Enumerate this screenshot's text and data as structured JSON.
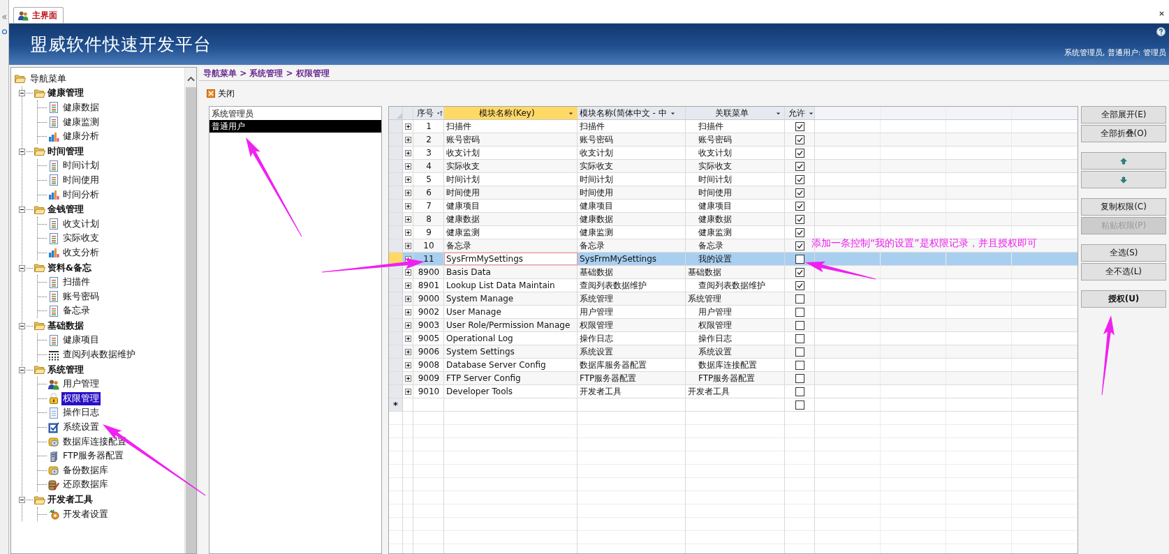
{
  "tab": {
    "label": "主界面",
    "selected": true
  },
  "header": {
    "title": "盟威软件快速开发平台",
    "user": "系统管理员, 普通用户: 管理员"
  },
  "nav": {
    "label": "导航菜单",
    "expanded": true,
    "children": [
      {
        "label": "健康管理",
        "expanded": true,
        "children": [
          {
            "label": "健康数据",
            "kind": "doc",
            "selected": false
          },
          {
            "label": "健康监测",
            "kind": "doc",
            "selected": false
          },
          {
            "label": "健康分析",
            "kind": "chart",
            "selected": false
          }
        ]
      },
      {
        "label": "时间管理",
        "expanded": true,
        "children": [
          {
            "label": "时间计划",
            "kind": "doc",
            "selected": false
          },
          {
            "label": "时间使用",
            "kind": "doc",
            "selected": false
          },
          {
            "label": "时间分析",
            "kind": "chart",
            "selected": false
          }
        ]
      },
      {
        "label": "金钱管理",
        "expanded": true,
        "children": [
          {
            "label": "收支计划",
            "kind": "doc",
            "selected": false
          },
          {
            "label": "实际收支",
            "kind": "doc",
            "selected": false
          },
          {
            "label": "收支分析",
            "kind": "chart",
            "selected": false
          }
        ]
      },
      {
        "label": "资料&备忘",
        "expanded": true,
        "children": [
          {
            "label": "扫描件",
            "kind": "doc",
            "selected": false
          },
          {
            "label": "账号密码",
            "kind": "doc",
            "selected": false
          },
          {
            "label": "备忘录",
            "kind": "doc",
            "selected": false
          }
        ]
      },
      {
        "label": "基础数据",
        "expanded": true,
        "children": [
          {
            "label": "健康项目",
            "kind": "doc",
            "selected": false
          },
          {
            "label": "查阅列表数据维护",
            "kind": "table",
            "selected": false
          }
        ]
      },
      {
        "label": "系统管理",
        "expanded": true,
        "children": [
          {
            "label": "用户管理",
            "kind": "users",
            "selected": false
          },
          {
            "label": "权限管理",
            "kind": "lock",
            "selected": true
          },
          {
            "label": "操作日志",
            "kind": "log",
            "selected": false
          },
          {
            "label": "系统设置",
            "kind": "settings",
            "selected": false
          },
          {
            "label": "数据库连接配置",
            "kind": "db",
            "selected": false
          },
          {
            "label": "FTP服务器配置",
            "kind": "server",
            "selected": false
          },
          {
            "label": "备份数据库",
            "kind": "db",
            "selected": false
          },
          {
            "label": "还原数据库",
            "kind": "restore",
            "selected": false
          }
        ]
      },
      {
        "label": "开发者工具",
        "expanded": true,
        "children": [
          {
            "label": "开发者设置",
            "kind": "devtools",
            "selected": false
          }
        ]
      }
    ]
  },
  "breadcrumb": "导航菜单 > 系统管理 > 权限管理",
  "toolbar": {
    "close": "关闭"
  },
  "roles": [
    {
      "label": "系统管理员",
      "selected": false
    },
    {
      "label": "普通用户",
      "selected": true
    }
  ],
  "columns": [
    {
      "label": "序号",
      "selected": false,
      "kind": "sort"
    },
    {
      "label": "模块名称(Key)",
      "selected": true,
      "kind": "filter"
    },
    {
      "label": "模块名称(简体中文 - 中",
      "selected": false,
      "kind": "filter"
    },
    {
      "label": "关联菜单",
      "selected": false,
      "kind": "filter"
    },
    {
      "label": "允许",
      "selected": false,
      "kind": "filter"
    }
  ],
  "rows": [
    {
      "seq": "1",
      "key": "扫描件",
      "name": "扫描件",
      "menu": "扫描件",
      "kind": "item",
      "allowed": true,
      "selected": false
    },
    {
      "seq": "2",
      "key": "账号密码",
      "name": "账号密码",
      "menu": "账号密码",
      "kind": "item",
      "allowed": true,
      "selected": false
    },
    {
      "seq": "3",
      "key": "收支计划",
      "name": "收支计划",
      "menu": "收支计划",
      "kind": "item",
      "allowed": true,
      "selected": false
    },
    {
      "seq": "4",
      "key": "实际收支",
      "name": "实际收支",
      "menu": "实际收支",
      "kind": "item",
      "allowed": true,
      "selected": false
    },
    {
      "seq": "5",
      "key": "时间计划",
      "name": "时间计划",
      "menu": "时间计划",
      "kind": "item",
      "allowed": true,
      "selected": false
    },
    {
      "seq": "6",
      "key": "时间使用",
      "name": "时间使用",
      "menu": "时间使用",
      "kind": "item",
      "allowed": true,
      "selected": false
    },
    {
      "seq": "7",
      "key": "健康项目",
      "name": "健康项目",
      "menu": "健康项目",
      "kind": "item",
      "allowed": true,
      "selected": false
    },
    {
      "seq": "8",
      "key": "健康数据",
      "name": "健康数据",
      "menu": "健康数据",
      "kind": "item",
      "allowed": true,
      "selected": false
    },
    {
      "seq": "9",
      "key": "健康监测",
      "name": "健康监测",
      "menu": "健康监测",
      "kind": "item",
      "allowed": true,
      "selected": false
    },
    {
      "seq": "10",
      "key": "备忘录",
      "name": "备忘录",
      "menu": "备忘录",
      "kind": "item",
      "allowed": true,
      "selected": false
    },
    {
      "seq": "11",
      "key": "SysFrmMySettings",
      "name": "SysFrmMySettings",
      "menu": "我的设置",
      "kind": "item",
      "allowed": false,
      "selected": true
    },
    {
      "seq": "8900",
      "key": "Basis Data",
      "name": "基础数据",
      "menu": "基础数据",
      "kind": "group",
      "allowed": true,
      "selected": false
    },
    {
      "seq": "8901",
      "key": "Lookup List Data Maintain",
      "name": "查阅列表数据维护",
      "menu": "查阅列表数据维护",
      "kind": "item",
      "allowed": true,
      "selected": false
    },
    {
      "seq": "9000",
      "key": "System Manage",
      "name": "系统管理",
      "menu": "系统管理",
      "kind": "group",
      "allowed": false,
      "selected": false
    },
    {
      "seq": "9002",
      "key": "User Manage",
      "name": "用户管理",
      "menu": "用户管理",
      "kind": "item",
      "allowed": false,
      "selected": false
    },
    {
      "seq": "9003",
      "key": "User Role/Permission Manage",
      "name": "权限管理",
      "menu": "权限管理",
      "kind": "item",
      "allowed": false,
      "selected": false
    },
    {
      "seq": "9005",
      "key": "Operational Log",
      "name": "操作日志",
      "menu": "操作日志",
      "kind": "item",
      "allowed": false,
      "selected": false
    },
    {
      "seq": "9006",
      "key": "System Settings",
      "name": "系统设置",
      "menu": "系统设置",
      "kind": "item",
      "allowed": false,
      "selected": false
    },
    {
      "seq": "9008",
      "key": "Database Server Config",
      "name": "数据库服务器配置",
      "menu": "数据库连接配置",
      "kind": "item",
      "allowed": false,
      "selected": false
    },
    {
      "seq": "9009",
      "key": "FTP Server Config",
      "name": "FTP服务器配置",
      "menu": "FTP服务器配置",
      "kind": "item",
      "allowed": false,
      "selected": false
    },
    {
      "seq": "9010",
      "key": "Developer Tools",
      "name": "开发者工具",
      "menu": "开发者工具",
      "kind": "group",
      "allowed": false,
      "selected": false
    }
  ],
  "new_row": {
    "marker": "*",
    "allowed": false
  },
  "button_groups": [
    [
      {
        "kind": "text",
        "label": "全部展开(E)",
        "disabled": false
      },
      {
        "kind": "text",
        "label": "全部折叠(O)",
        "disabled": false
      }
    ],
    [
      {
        "kind": "up",
        "disabled": false
      },
      {
        "kind": "down",
        "disabled": false
      }
    ],
    [
      {
        "kind": "text",
        "label": "复制权限(C)",
        "disabled": false
      },
      {
        "kind": "text",
        "label": "粘贴权限(P)",
        "disabled": true
      }
    ],
    [
      {
        "kind": "text",
        "label": "全选(S)",
        "disabled": false
      },
      {
        "kind": "text",
        "label": "全不选(L)",
        "disabled": false
      }
    ],
    [
      {
        "kind": "strong",
        "label": "授权(U)",
        "disabled": false
      }
    ]
  ],
  "annotation": "添加一条控制“我的设置”是权限记录，并且授权即可"
}
